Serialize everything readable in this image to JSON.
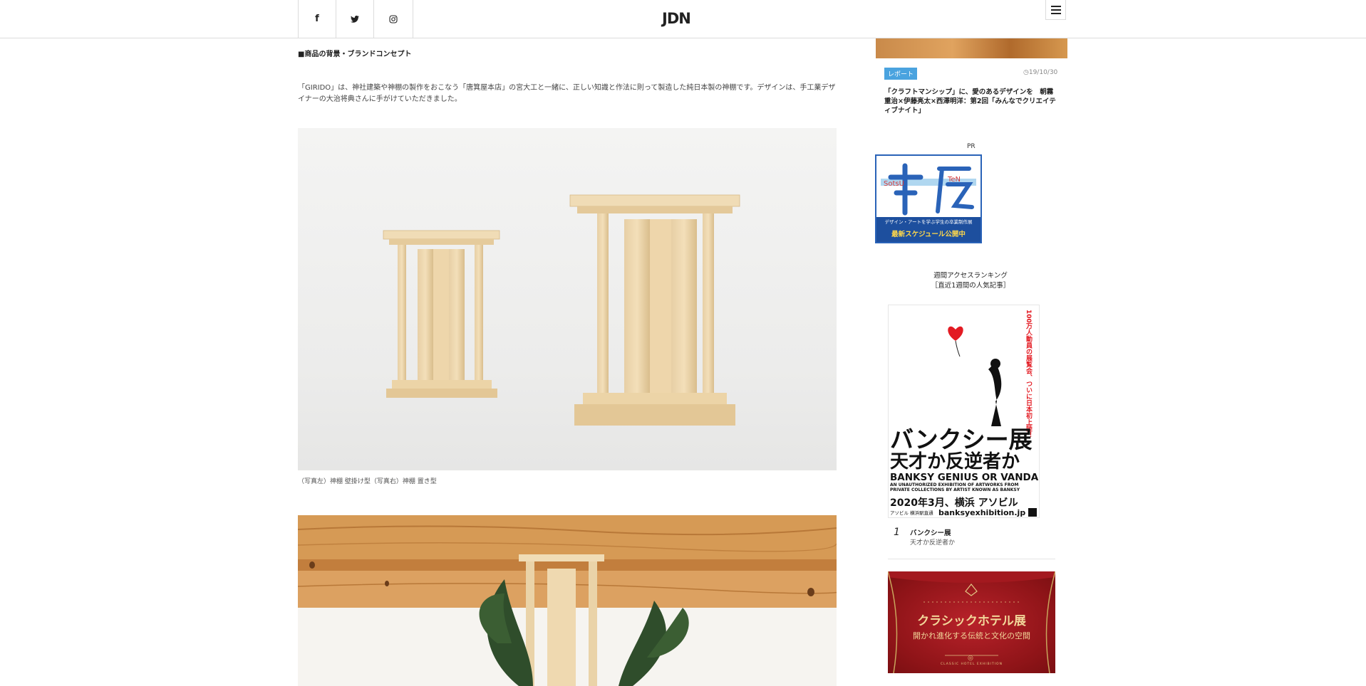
{
  "header": {
    "logo": "JDN",
    "social": [
      {
        "icon": "facebook-icon",
        "glyph": "f"
      },
      {
        "icon": "twitter-icon",
        "glyph": "🐦"
      },
      {
        "icon": "instagram-icon",
        "glyph": "◎"
      }
    ]
  },
  "article": {
    "section_heading": "■商品の背景・ブランドコンセプト",
    "body": "「GIRIDO」は、神社建築や神棚の製作をおこなう「唐箕屋本店」の宮大工と一緒に、正しい知識と作法に則って製造した純日本製の神棚です。デザインは、手工業デザイナーの大治将典さんに手がけていただきました。",
    "photo1_caption": "（写真左）神棚 壁掛け型（写真右）神棚 置き型"
  },
  "sidebar": {
    "top_article": {
      "tag": "レポート",
      "date": "19/10/30",
      "title": "「クラフトマンシップ」に、愛のあるデザインを　朝霧重治×伊藤亮太×西澤明洋：第2回「みんなでクリエイティブナイト」"
    },
    "pr": {
      "label": "PR",
      "banner_logo": "卒展",
      "banner_middle": "デザイン・アートを学ぶ学生の卒業制作展",
      "banner_bottom": "最新スケジュール公開中"
    },
    "ranking": {
      "heading_line1": "週間アクセスランキング",
      "heading_line2": "［直近1週間の人気記事］",
      "items": [
        {
          "num": "1",
          "title": "バンクシー展",
          "subtitle": "天才か反逆者か",
          "poster": {
            "vertical_text": "100万人動員の展覧会、ついに日本初上陸！",
            "big1": "バンクシー展",
            "big2": "天才か反逆者か",
            "en1": "BANKSY GENIUS OR VANDAL?",
            "en2": "AN UNAUTHORIZED EXHIBITION OF ARTWORKS FROM PRIVATE COLLECTIONS BY ARTIST KNOWN AS BANKSY",
            "date": "2020年3月、横浜 アソビル",
            "venue": "アソビル 横浜駅直通",
            "url": "banksyexhibition.jp"
          }
        },
        {
          "poster": {
            "title": "クラシックホテル展",
            "subtitle": "開かれ進化する伝統と文化の空間",
            "footer": "CLASSIC HOTEL EXHIBITION"
          }
        }
      ]
    }
  }
}
